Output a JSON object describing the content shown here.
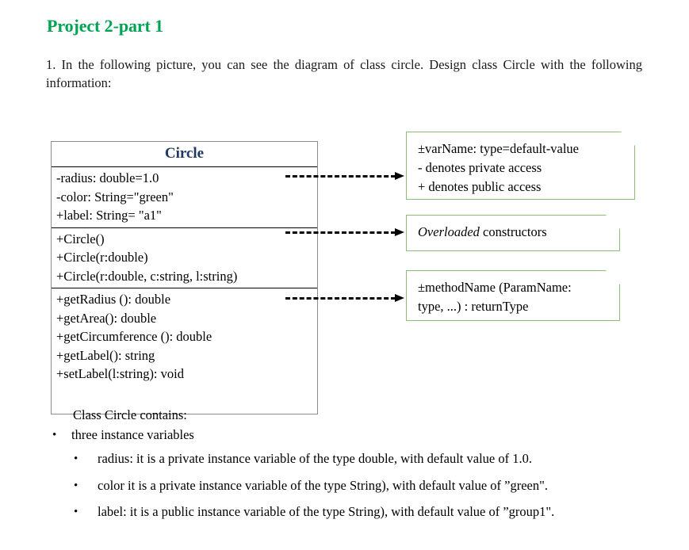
{
  "document": {
    "title": "Project 2-part 1",
    "title_color": "#00a352",
    "intro": "1. In the following picture, you can see the diagram of class circle. Design class Circle with the following information:"
  },
  "class_diagram": {
    "class_name": "Circle",
    "class_name_color": "#1f3864",
    "attributes": [
      "-radius: double=1.0",
      "-color: String=\"green\"",
      "+label: String= \"a1\""
    ],
    "constructors": [
      "+Circle()",
      "+Circle(r:double)",
      "+Circle(r:double, c:string, l:string)"
    ],
    "methods": [
      "+getRadius (): double",
      "+getArea(): double",
      "+getCircumference (): double",
      "+getLabel(): string",
      "+setLabel(l:string): void"
    ]
  },
  "notes": {
    "border_color": "#8fbc78",
    "attribute_note": [
      "±varName: type=default-value",
      "- denotes private access",
      "+ denotes public access"
    ],
    "constructor_note": {
      "emphasis": "Overloaded",
      "rest": " constructors"
    },
    "method_note": [
      "±methodName (ParamName:",
      "type, ...) : returnType"
    ]
  },
  "description": {
    "lead": "Class Circle contains:",
    "main_bullet": "three instance variables",
    "bullet_glyph": "•",
    "sub_bullets": [
      "radius: it is a private instance variable of the type double, with default value of 1.0.",
      "color it is a private instance variable of the type String), with default value of ”green\".",
      "label: it is a public instance variable of the type String), with default value of ”group1\"."
    ]
  }
}
